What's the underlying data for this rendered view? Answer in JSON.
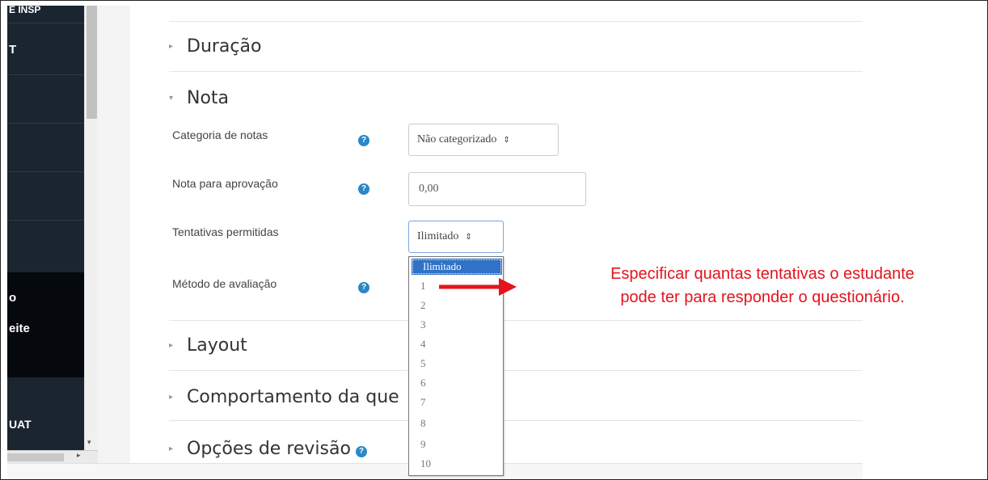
{
  "sidebar": {
    "items": [
      {
        "label": "E INSP"
      },
      {
        "label": "T"
      },
      {
        "label": ""
      },
      {
        "label": ""
      },
      {
        "label": ""
      },
      {
        "label": "o"
      },
      {
        "label": "eite"
      },
      {
        "label": "UAT"
      }
    ]
  },
  "sections": {
    "duracao": "Duração",
    "nota": "Nota",
    "layout": "Layout",
    "comportamento": "Comportamento da que",
    "opcoes": "Opções de revisão"
  },
  "nota": {
    "categoria_label": "Categoria de notas",
    "categoria_value": "Não categorizado",
    "aprovacao_label": "Nota para aprovação",
    "aprovacao_value": "0,00",
    "tentativas_label": "Tentativas permitidas",
    "tentativas_value": "Ilimitado",
    "metodo_label": "Método de avaliação"
  },
  "dropdown": {
    "options": [
      "Ilimitado",
      "1",
      "2",
      "3",
      "4",
      "5",
      "6",
      "7",
      "8",
      "9",
      "10"
    ],
    "selected": "Ilimitado"
  },
  "annotation": {
    "line1": "Especificar quantas tentativas o estudante",
    "line2": "pode ter para responder o questionário."
  },
  "colors": {
    "sidebar_bg": "#1a2530",
    "help_icon": "#2a87c8",
    "selected_option": "#2f72c7",
    "annotation_red": "#e3141c"
  },
  "icons": {
    "help": "question-circle-icon",
    "expand": "caret-right-icon",
    "collapse": "caret-down-icon"
  }
}
